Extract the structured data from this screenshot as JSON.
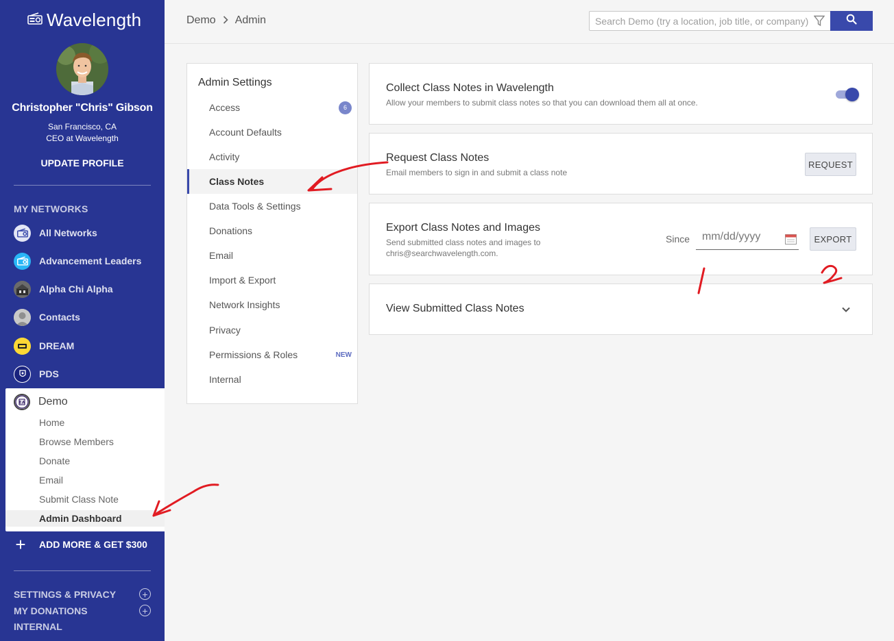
{
  "app": {
    "brand": "Wavelength"
  },
  "profile": {
    "name": "Christopher \"Chris\" Gibson",
    "location": "San Francisco, CA",
    "title": "CEO at Wavelength",
    "update_label": "UPDATE PROFILE"
  },
  "sidebar": {
    "networks_heading": "MY NETWORKS",
    "networks": [
      {
        "label": "All Networks",
        "icon": "radio-icon"
      },
      {
        "label": "Advancement Leaders",
        "icon": "radio-icon"
      },
      {
        "label": "Alpha Chi Alpha",
        "icon": "network-logo"
      },
      {
        "label": "Contacts",
        "icon": "person-silhouette"
      },
      {
        "label": "DREAM",
        "icon": "network-logo"
      },
      {
        "label": "PDS",
        "icon": "crest-logo"
      }
    ],
    "demo": {
      "label": "Demo",
      "links": [
        "Home",
        "Browse Members",
        "Donate",
        "Email",
        "Submit Class Note",
        "Admin Dashboard"
      ],
      "active": "Admin Dashboard"
    },
    "add_more_label": "ADD MORE & GET $300",
    "bottom": [
      {
        "label": "SETTINGS & PRIVACY"
      },
      {
        "label": "MY DONATIONS"
      },
      {
        "label": "INTERNAL"
      }
    ]
  },
  "header": {
    "breadcrumb": [
      "Demo",
      "Admin"
    ],
    "search_placeholder": "Search Demo (try a location, job title, or company)"
  },
  "settings_nav": {
    "title": "Admin Settings",
    "items": [
      {
        "label": "Access",
        "badge": "6"
      },
      {
        "label": "Account Defaults"
      },
      {
        "label": "Activity"
      },
      {
        "label": "Class Notes",
        "active": true
      },
      {
        "label": "Data Tools & Settings"
      },
      {
        "label": "Donations"
      },
      {
        "label": "Email"
      },
      {
        "label": "Import & Export"
      },
      {
        "label": "Network Insights"
      },
      {
        "label": "Privacy"
      },
      {
        "label": "Permissions & Roles",
        "tag": "NEW"
      },
      {
        "label": "Internal"
      }
    ]
  },
  "cards": {
    "collect": {
      "title": "Collect Class Notes in Wavelength",
      "desc": "Allow your members to submit class notes so that you can download them all at once.",
      "enabled": true
    },
    "request": {
      "title": "Request Class Notes",
      "desc": "Email members to sign in and submit a class note",
      "button": "REQUEST"
    },
    "export": {
      "title": "Export Class Notes and Images",
      "desc_line1": "Send submitted class notes and images to",
      "desc_line2": "chris@searchwavelength.com.",
      "since_label": "Since",
      "date_placeholder": "mm/dd/yyyy",
      "button": "EXPORT"
    },
    "view": {
      "title": "View Submitted Class Notes"
    }
  },
  "accent_color": "#3949ab",
  "sidebar_color": "#283593",
  "annotation_color": "#e11b22"
}
